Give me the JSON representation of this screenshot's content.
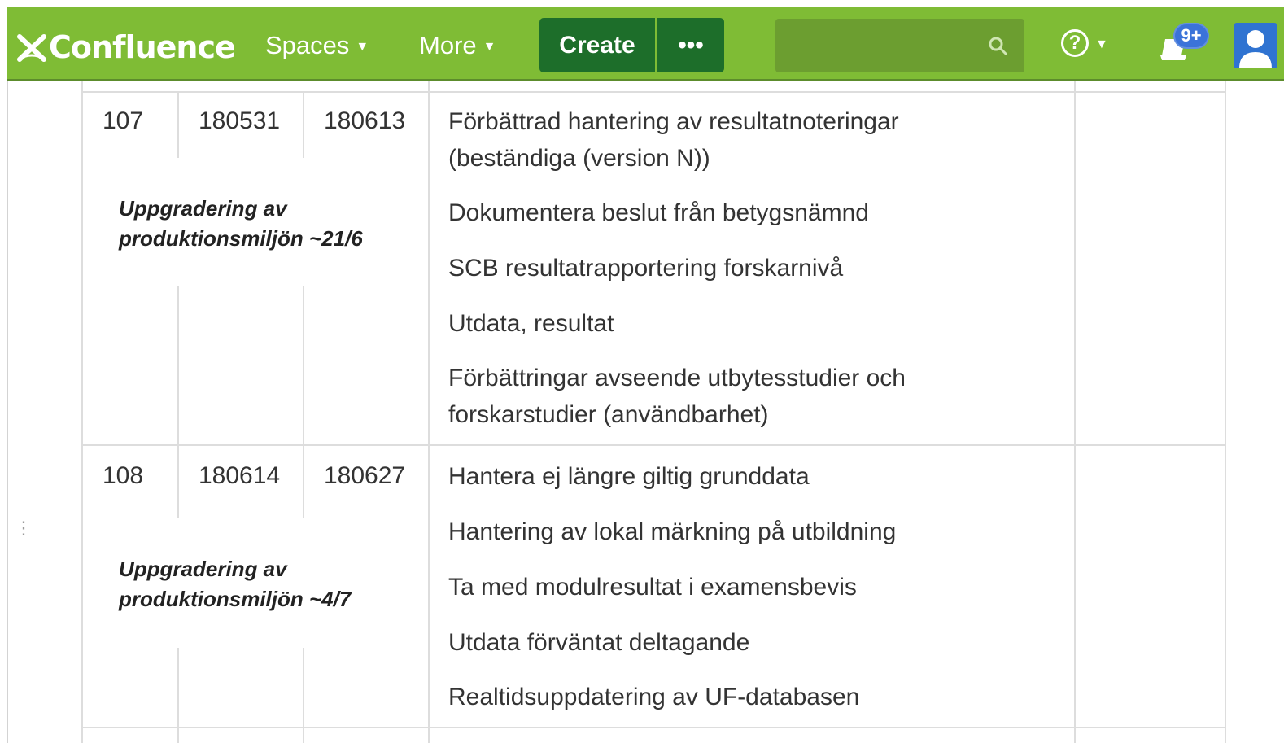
{
  "app": {
    "name": "Confluence"
  },
  "nav": {
    "spaces_label": "Spaces",
    "more_label": "More",
    "create_label": "Create",
    "more_actions_label": "•••",
    "notifications_badge": "9+"
  },
  "table": {
    "rows": [
      {
        "c1": "107",
        "c2": "180531",
        "c3": "180613",
        "note_line1": "Uppgradering av",
        "note_line2": "produktionsmiljön ~21/6",
        "items": [
          "Förbättrad hantering av resultatnoteringar",
          "(beständiga (version N))",
          "Dokumentera beslut från betygsnämnd",
          "SCB resultatrapportering forskarnivå",
          "Utdata, resultat",
          "Förbättringar avseende utbytesstudier och",
          "forskarstudier (användbarhet)"
        ]
      },
      {
        "c1": "108",
        "c2": "180614",
        "c3": "180627",
        "note_line1": "Uppgradering av",
        "note_line2": "produktionsmiljön ~4/7",
        "items": [
          "Hantera ej längre giltig grunddata",
          "Hantering av lokal märkning på utbildning",
          "Ta med modulresultat i examensbevis",
          "Utdata förväntat deltagande",
          "Realtidsuppdatering av UF-databasen"
        ]
      }
    ]
  },
  "colors": {
    "topbar": "#7fbc35",
    "create_button": "#1d6e2a",
    "search_field": "#6c9e30",
    "badge": "#3b73d9",
    "avatar": "#2f73d1"
  }
}
